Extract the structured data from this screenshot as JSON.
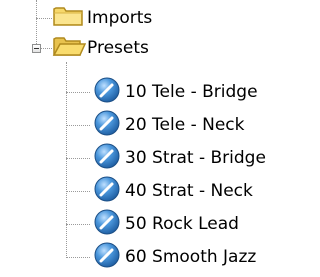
{
  "tree": {
    "folders": [
      {
        "label": "Imports",
        "icon": "folder-closed-icon",
        "expanded": false
      },
      {
        "label": "Presets",
        "icon": "folder-open-icon",
        "expanded": true
      }
    ],
    "presets": [
      {
        "label": "10 Tele - Bridge",
        "icon": "preset-ball-icon"
      },
      {
        "label": "20 Tele - Neck",
        "icon": "preset-ball-icon"
      },
      {
        "label": "30 Strat - Bridge",
        "icon": "preset-ball-icon"
      },
      {
        "label": "40 Strat - Neck",
        "icon": "preset-ball-icon"
      },
      {
        "label": "50 Rock Lead",
        "icon": "preset-ball-icon"
      },
      {
        "label": "60 Smooth Jazz",
        "icon": "preset-ball-icon"
      }
    ]
  },
  "colors": {
    "folder_fill": "#f7d86a",
    "folder_edge": "#b08a1e",
    "ball_blue": "#2f7fc7",
    "ball_highlight": "#bfe0ff",
    "connector": "#9a9a9a"
  }
}
